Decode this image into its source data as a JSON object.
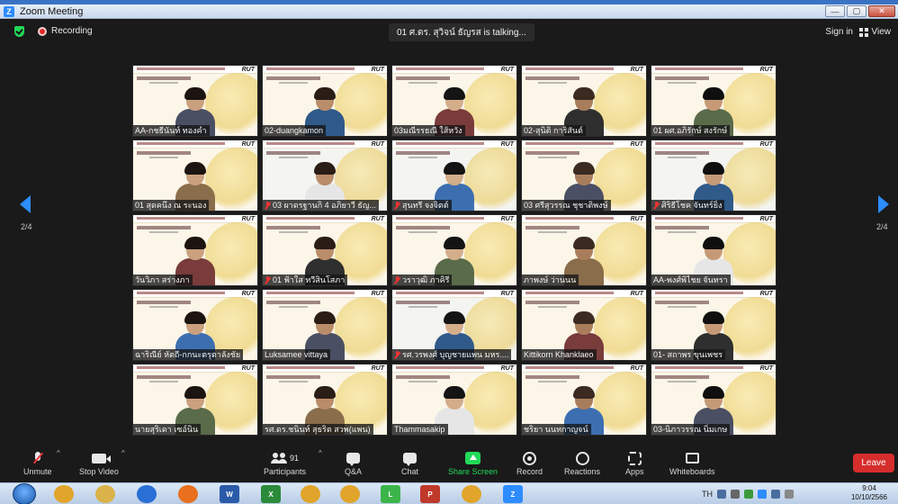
{
  "window": {
    "title": "Zoom Meeting",
    "logo_letter": "Z",
    "controls": [
      "—",
      "▢",
      "✕"
    ]
  },
  "meeting_bar": {
    "recording_label": "Recording",
    "talking_text": "01 ศ.ดร. สุวิจน์ ธัญรส is talking...",
    "sign_in_label": "Sign in",
    "view_label": "View"
  },
  "gallery": {
    "page_left": "2/4",
    "page_right": "2/4",
    "slide_badge": "RUT",
    "participants": [
      {
        "name": "AA-กชธีนันท์ ทองคำ",
        "muted": false
      },
      {
        "name": "02-duangkamon",
        "muted": false
      },
      {
        "name": "03มณีรรธณี  ใส้หวัง",
        "muted": false
      },
      {
        "name": "02-สุนิติ การิสันต์",
        "muted": false
      },
      {
        "name": "01 ผศ.อภิรักษ์  สงรักษ์",
        "muted": false
      },
      {
        "name": "01 สุดคนึง ณ ระนอง",
        "muted": false
      },
      {
        "name": "03 ผาดรฐานกิ 4 อภิยาวี ธัญ...",
        "muted": true
      },
      {
        "name": "สุนทรี จงจิตต์",
        "muted": true
      },
      {
        "name": "03 ศรีสุวรรณ ชุชาติพงษ์",
        "muted": false
      },
      {
        "name": "ศิริธีโชค จันทร์ยิ่ง",
        "muted": true
      },
      {
        "name": "วันวิภา สร่างภา",
        "muted": false
      },
      {
        "name": "01 ฟ้าใส ทวีสินโสภา",
        "muted": true
      },
      {
        "name": "วราวุฒิ ภาคิรี",
        "muted": true
      },
      {
        "name": "ภาพงษ์ ว่านนน",
        "muted": false
      },
      {
        "name": "AA-พงศ์พิไชย จันทรา",
        "muted": false
      },
      {
        "name": "ฉาริณีย์ หัตถี-กกนะตรุตาลังชัย",
        "muted": false
      },
      {
        "name": "Luksamee vittaya",
        "muted": false
      },
      {
        "name": "รศ.วรพงศ์ บุญชายแพน มหร....",
        "muted": true
      },
      {
        "name": "Kittikorn Khanklaeo",
        "muted": false
      },
      {
        "name": "01- สถาพร ขุนเพชร",
        "muted": false
      },
      {
        "name": "นายสุริเดา  เซอ์นิน",
        "muted": false
      },
      {
        "name": "รศ.ดร.ชนินท์ สุธริต สวพ(แพน)",
        "muted": false
      },
      {
        "name": "Thammasakip",
        "muted": false
      },
      {
        "name": "ชริยา นนทกาญจน์",
        "muted": false
      },
      {
        "name": "03-นิภาวรรณ  นิ่มเกษ",
        "muted": false
      }
    ]
  },
  "toolbar": {
    "unmute": "Unmute",
    "stop_video": "Stop Video",
    "participants": "Participants",
    "participant_count": "91",
    "qa": "Q&A",
    "chat": "Chat",
    "share_screen": "Share Screen",
    "record": "Record",
    "reactions": "Reactions",
    "apps": "Apps",
    "whiteboards": "Whiteboards",
    "leave": "Leave",
    "caret": "^"
  },
  "taskbar": {
    "apps": [
      "Chrome",
      "Explorer",
      "Internet Explorer",
      "Firefox",
      "W",
      "X",
      "Chrome",
      "Chrome",
      "LINE",
      "PDF",
      "Chrome",
      "Z"
    ],
    "tray_lang": "TH",
    "time": "9:04",
    "date": "10/10/2566"
  },
  "colors": {
    "accent": "#2d8cff",
    "share_green": "#23d959",
    "leave_red": "#d62d2d"
  }
}
